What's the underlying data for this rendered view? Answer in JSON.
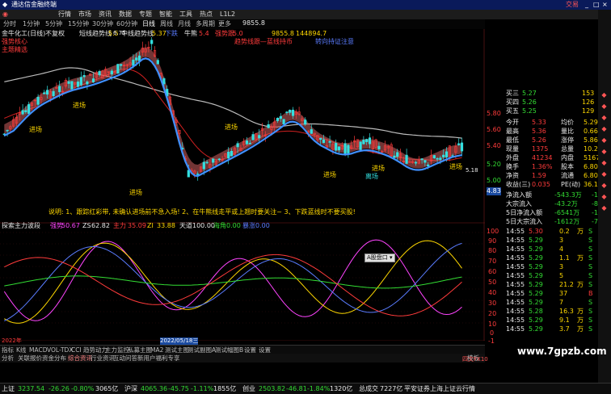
{
  "window": {
    "title": "通达信金融终端",
    "top_right": "交易",
    "menu": [
      "行情",
      "市场",
      "资讯",
      "数据",
      "专题",
      "智能",
      "工具",
      "热点",
      "L1L2"
    ],
    "period_tabs": [
      "分时",
      "1分钟",
      "5分钟",
      "15分钟",
      "30分钟",
      "60分钟",
      "日线",
      "周线",
      "月线",
      "多周期",
      "更多"
    ]
  },
  "chart_header": {
    "stock": "金牛化工(日线)",
    "mode": "不复权",
    "ind1": "短线趋势线",
    "ind1_val": "5.5",
    "ind2": "中线趋势线",
    "ind2_val": "5.37",
    "ind3": "下跌",
    "ind4": "牛熊",
    "ind4_val": "5.4",
    "ind5": "强势跟",
    "ind5_val": "5.0",
    "val6": "9855.8",
    "val7": "144894.7",
    "sub1": "强势核心",
    "sub2": "主题精选",
    "tip1": "趋势线跟—蓝线持币",
    "tip2": "转向持证注意",
    "price_top": "6.75",
    "price_low": "4.83",
    "price_low2": "5.18"
  },
  "annotations": {
    "enter": "进场",
    "exit": "离场",
    "strategy": "主力"
  },
  "notice": "说明: 1、跟踪红彩带, 未确认进场前不急入场! 2、在牛熊线走平或上翘时要关注~ 3、下跌蓝线时不要买股!",
  "sub_header": {
    "name": "探索主力波段",
    "a_label": "强势",
    "a_val": "50.67",
    "b_label": "ZS",
    "b_val": "62.82",
    "c_label": "主力",
    "c_val": "35.09",
    "d_label": "ZI",
    "d_val": "33.88",
    "e_label": "天道",
    "e_val": "100.00",
    "f_label": "海角",
    "f_val": "0.00",
    "g_label": "暴涨",
    "g_val": "0.00"
  },
  "popup": "A股盘口 ▾",
  "y_axis_main": [
    "5.80",
    "5.60",
    "5.40",
    "5.20",
    "5.00",
    "4.83"
  ],
  "y_axis_sub": [
    "100",
    "90",
    "80",
    "70",
    "60",
    "50",
    "40",
    "30",
    "20",
    "10",
    "0",
    "-1"
  ],
  "date_left": "2022年",
  "date_cursor": "2022/05/18三",
  "quote": {
    "rows": [
      {
        "l": "买三",
        "v": "5.27",
        "q": "153"
      },
      {
        "l": "买四",
        "v": "5.26",
        "q": "126"
      },
      {
        "l": "买五",
        "v": "5.25",
        "q": "129"
      }
    ],
    "stats": [
      {
        "l": "今开",
        "v": "5.33",
        "l2": "均价",
        "v2": "5.29"
      },
      {
        "l": "最高",
        "v": "5.36",
        "l2": "量比",
        "v2": "0.66"
      },
      {
        "l": "最低",
        "v": "5.26",
        "l2": "涨停",
        "v2": "5.86"
      },
      {
        "l": "现量",
        "v": "1375",
        "l2": "总量",
        "v2": "10.2万"
      },
      {
        "l": "外盘",
        "v": "41234",
        "l2": "内盘",
        "v2": "51670"
      },
      {
        "l": "换手",
        "v": "1.36%",
        "l2": "股本",
        "v2": "6.80亿"
      },
      {
        "l": "净资",
        "v": "1.59",
        "l2": "流通",
        "v2": "6.80亿"
      },
      {
        "l": "收益(三)",
        "v": "0.035",
        "l2": "PE(动)",
        "v2": "36.1"
      }
    ],
    "flows": [
      {
        "l": "净流入额",
        "v": "-543.3万",
        "p": "-15%"
      },
      {
        "l": "大宗流入",
        "v": "-43.2万",
        "p": "-8%"
      },
      {
        "l": "5日净流入额",
        "v": "-6541万",
        "p": "-16%"
      },
      {
        "l": "5日大宗流入",
        "v": "-1612万",
        "p": "-7%"
      }
    ],
    "ticks": [
      {
        "t": "14:55",
        "p": "5.30",
        "v": "0.2",
        "s": "万",
        "f": "S"
      },
      {
        "t": "14:55",
        "p": "5.29",
        "v": "3",
        "s": "",
        "f": "S"
      },
      {
        "t": "14:55",
        "p": "5.29",
        "v": "4",
        "s": "",
        "f": "S"
      },
      {
        "t": "14:55",
        "p": "5.29",
        "v": "1.1",
        "s": "万",
        "f": "S"
      },
      {
        "t": "14:55",
        "p": "5.29",
        "v": "3",
        "s": "",
        "f": "S"
      },
      {
        "t": "14:55",
        "p": "5.29",
        "v": "5",
        "s": "",
        "f": "S"
      },
      {
        "t": "14:55",
        "p": "5.29",
        "v": "21.2",
        "s": "万",
        "f": "S"
      },
      {
        "t": "14:55",
        "p": "5.29",
        "v": "37",
        "s": "",
        "f": "B"
      },
      {
        "t": "14:55",
        "p": "5.29",
        "v": "7",
        "s": "",
        "f": "S"
      },
      {
        "t": "14:55",
        "p": "5.28",
        "v": "16.3",
        "s": "万",
        "f": "S"
      },
      {
        "t": "14:55",
        "p": "5.29",
        "v": "9.1",
        "s": "万",
        "f": "S"
      },
      {
        "t": "14:55",
        "p": "5.29",
        "v": "3.7",
        "s": "万",
        "f": "S"
      },
      {
        "t": "14:56",
        "p": "5.29",
        "v": "1.9",
        "s": "万",
        "f": "S"
      },
      {
        "t": "14:56",
        "p": "5.29",
        "v": "10.8",
        "s": "万",
        "f": "S"
      },
      {
        "t": "14:56",
        "p": "5.29",
        "v": "10",
        "s": "",
        "f": "B"
      },
      {
        "t": "14:56",
        "p": "5.28",
        "v": "4.4",
        "s": "万",
        "f": "S"
      },
      {
        "t": "14:56",
        "p": "5.28",
        "v": "6",
        "s": "",
        "f": "S"
      },
      {
        "t": "14:56",
        "p": "5.29",
        "v": "10",
        "s": "",
        "f": "B"
      },
      {
        "t": "14:56",
        "p": "5.29",
        "v": "1.7",
        "s": "万",
        "f": "B"
      },
      {
        "t": "14:56",
        "p": "5.29",
        "v": "41",
        "s": "",
        "f": "S"
      },
      {
        "t": "14:56",
        "p": "5.29",
        "v": "4.2",
        "s": "万",
        "f": "S"
      },
      {
        "t": "14:56",
        "p": "5.29",
        "v": "2.6",
        "s": "万",
        "f": "B"
      },
      {
        "t": "14:56",
        "p": "5.29",
        "v": "2",
        "s": "",
        "f": "B"
      },
      {
        "t": "14:56",
        "p": "5.29",
        "v": "3",
        "s": "",
        "f": "S"
      },
      {
        "t": "14:57",
        "p": "5.30",
        "v": "2",
        "s": "",
        "f": "S"
      },
      {
        "t": "15:00",
        "p": "5.28",
        "v": "13.3",
        "s": "万",
        "f": "S"
      }
    ]
  },
  "tabs": [
    "指标",
    "K线",
    "MACD",
    "VOL-TDX",
    "CCI",
    "趋势动力",
    "主力监控",
    "私募主图",
    "MA2",
    "测试主图",
    "测试副图A",
    "测试幅图B",
    "设置",
    "设置"
  ],
  "tabs2": [
    "分析",
    "关联报价",
    "资金分布",
    "综合资讯",
    "行业资讯",
    "互动问答",
    "新用户福利专享"
  ],
  "tabs2_right": "模板",
  "statusbar": [
    {
      "n": "上证",
      "v": "3237.54",
      "c": "-26.26",
      "p": "-0.80%",
      "a": "3065亿"
    },
    {
      "n": "沪深",
      "v": "4065.36",
      "c": "-45.75",
      "p": "-1.11%",
      "a": "1855亿"
    },
    {
      "n": "创业",
      "v": "2503.82",
      "c": "-46.81",
      "p": "-1.84%",
      "a": "1320亿"
    }
  ],
  "status_extra": "总成交",
  "status_extra_v": "7227亿",
  "status_server": "平安证券上海上证云行情",
  "watermark": "www.7gpzb.com",
  "extra_right": "四文FX10",
  "colors": {
    "up": "#ff3b3b",
    "down": "#33dd33",
    "bg": "#000000"
  }
}
